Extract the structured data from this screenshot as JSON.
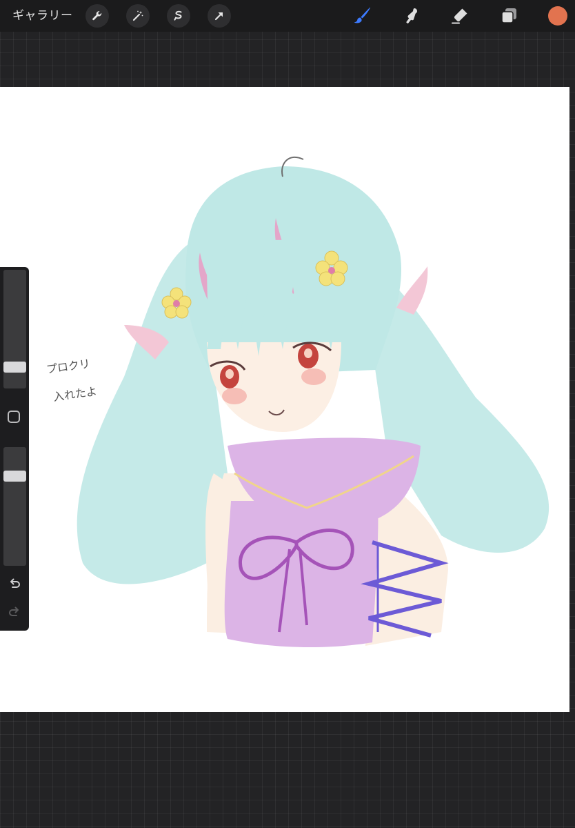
{
  "toolbar": {
    "gallery_label": "ギャラリー",
    "tools_left": [
      "wrench-icon",
      "magic-wand-icon",
      "selection-icon",
      "transform-arrow-icon"
    ],
    "tools_right": [
      "brush-icon",
      "smudge-icon",
      "eraser-icon",
      "layers-icon"
    ],
    "active_tool": "brush-icon",
    "current_color": "#e2734f"
  },
  "sidebar": {
    "brush_size_level": 0.85,
    "opacity_level": 0.22,
    "undo_icon": "undo-icon",
    "redo_icon": "redo-icon"
  },
  "canvas": {
    "note_line1": "プロクリ",
    "note_line2": "入れたよ",
    "background": "#ffffff"
  }
}
